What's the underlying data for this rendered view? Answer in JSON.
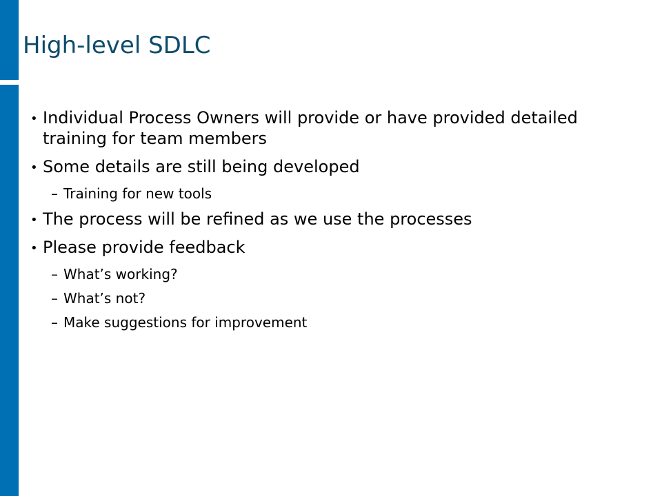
{
  "slide": {
    "title": "High-level SDLC",
    "bullets": [
      {
        "text": "Individual Process Owners will provide or have provided detailed training for team members",
        "subs": []
      },
      {
        "text": "Some details are still being developed",
        "subs": [
          "Training for new tools"
        ]
      },
      {
        "text": "The process will be refined as we use the processes",
        "subs": []
      },
      {
        "text": "Please provide feedback",
        "subs": [
          "What’s working?",
          "What’s not?",
          "Make suggestions for improvement"
        ]
      }
    ]
  },
  "colors": {
    "accent_bar": "#0070b5",
    "title_text": "#0d4b6b"
  }
}
